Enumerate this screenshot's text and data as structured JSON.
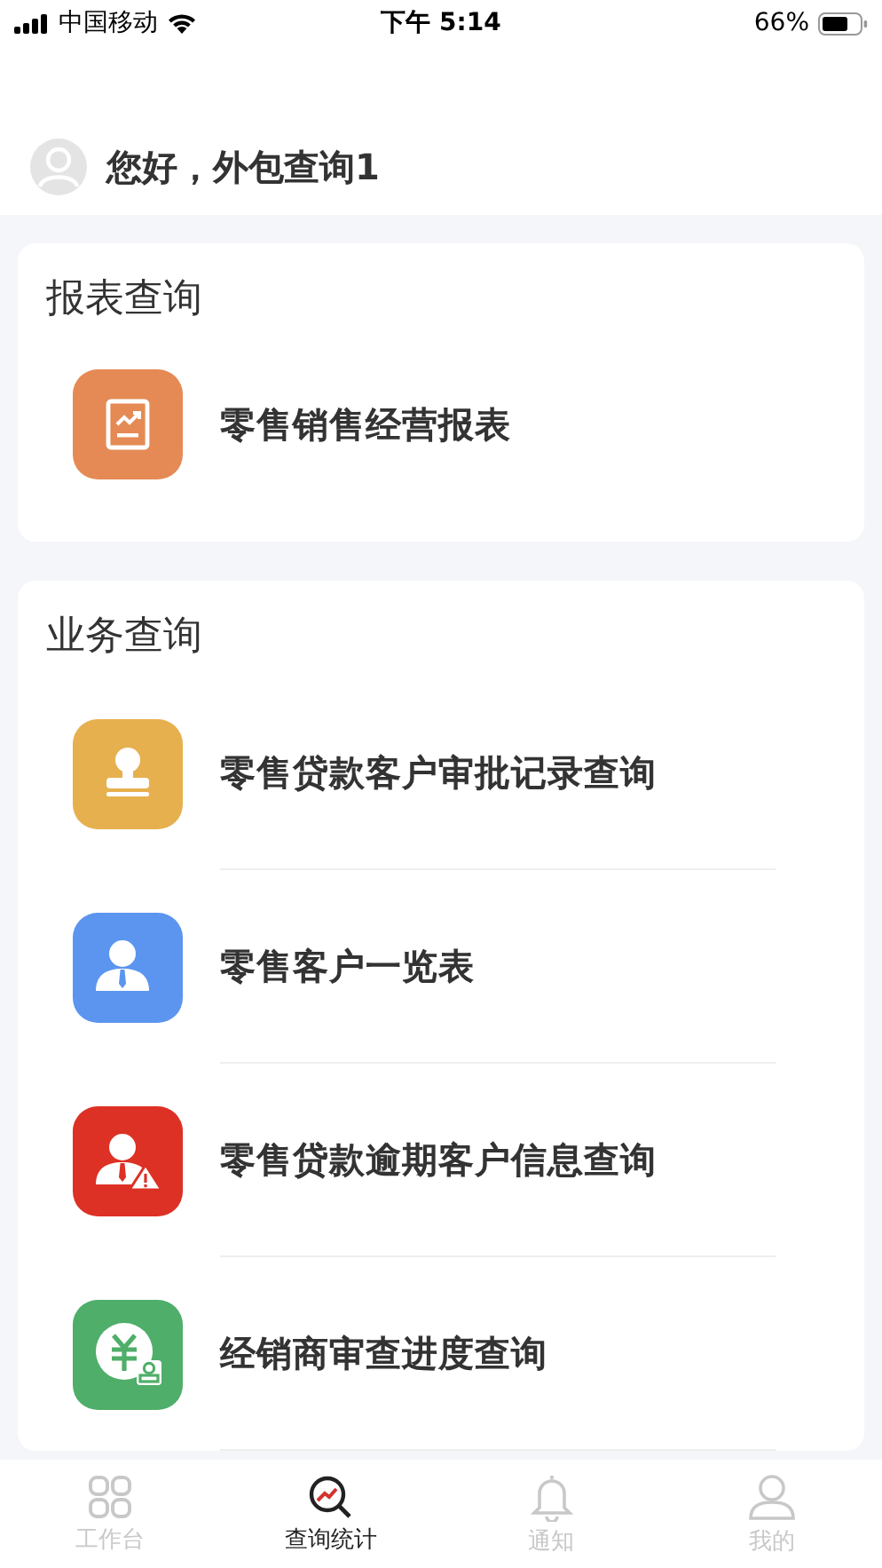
{
  "status_bar": {
    "carrier": "中国移动",
    "time": "下午 5:14",
    "battery": "66%"
  },
  "greeting": "您好，外包查询1",
  "sections": [
    {
      "title": "报表查询",
      "items": [
        {
          "label": "零售销售经营报表",
          "kind": "report",
          "color": "#e58a55"
        }
      ]
    },
    {
      "title": "业务查询",
      "items": [
        {
          "label": "零售贷款客户审批记录查询",
          "kind": "stamp",
          "color": "#e6b04f"
        },
        {
          "label": "零售客户一览表",
          "kind": "person",
          "color": "#5b95ef"
        },
        {
          "label": "零售贷款逾期客户信息查询",
          "kind": "person-alert",
          "color": "#dc3124"
        },
        {
          "label": "经销商审查进度查询",
          "kind": "money",
          "color": "#4fae69"
        }
      ]
    }
  ],
  "tab_bar": [
    {
      "label": "工作台",
      "kind": "grid",
      "selected": false
    },
    {
      "label": "查询统计",
      "kind": "stats",
      "selected": true
    },
    {
      "label": "通知",
      "kind": "bell",
      "selected": false
    },
    {
      "label": "我的",
      "kind": "user",
      "selected": false
    }
  ]
}
